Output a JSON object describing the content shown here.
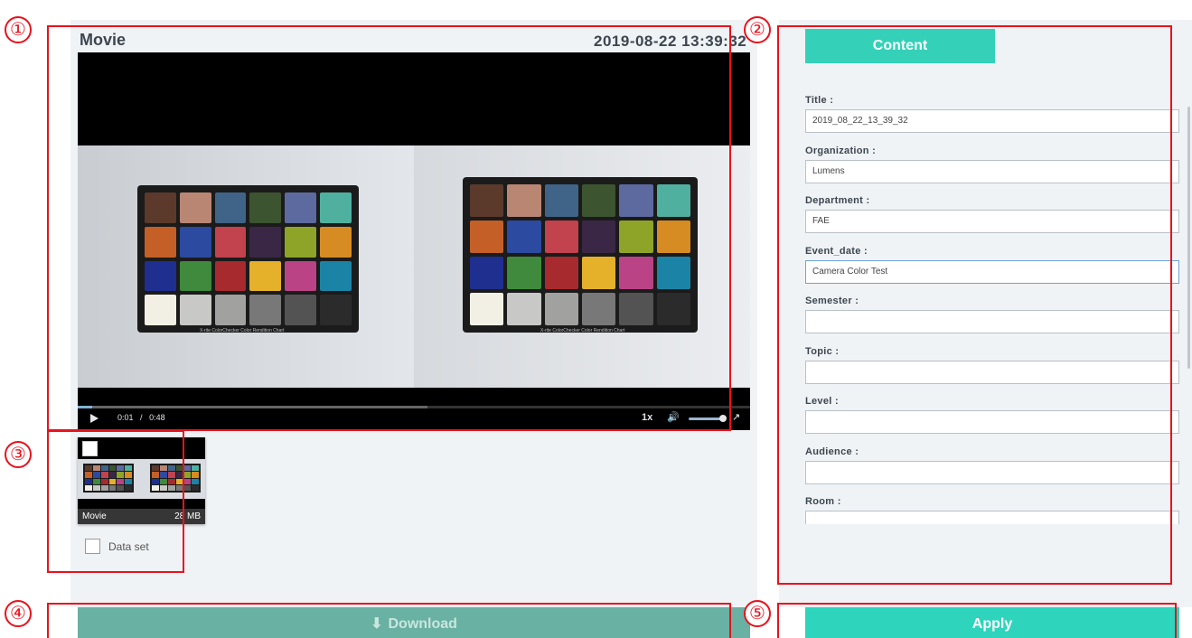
{
  "player": {
    "title": "Movie",
    "timestamp": "2019-08-22  13:39:32",
    "current_time": "0:01",
    "separator": "/",
    "duration": "0:48",
    "speed": "1x",
    "progress_fraction": 0.021,
    "buffered_fraction": 0.52,
    "volume_fraction": 1.0,
    "chart_caption": "X-rite ColorChecker  Color Rendition Chart",
    "icons": {
      "play": "play-icon",
      "volume": "volume-icon",
      "fullscreen": "fullscreen-icon"
    },
    "swatch_colors": [
      "#5b3a2c",
      "#b98673",
      "#3f6488",
      "#3c5530",
      "#5d6aa0",
      "#4fb0a0",
      "#c45f27",
      "#2b4aa0",
      "#c2424d",
      "#3a2746",
      "#8ea429",
      "#d68c23",
      "#1f2f8f",
      "#3f8a3c",
      "#a72b2e",
      "#e5b02a",
      "#b94384",
      "#1b84a6",
      "#f2f0e4",
      "#c8c8c6",
      "#a1a1a0",
      "#787878",
      "#535353",
      "#2b2b2b"
    ]
  },
  "thumbnail": {
    "name": "Movie",
    "size": "28 MB",
    "checkbox_checked": false
  },
  "dataset": {
    "label": "Data set",
    "checked": false
  },
  "content": {
    "tab_label": "Content",
    "fields": [
      {
        "label": "Title :",
        "value": "2019_08_22_13_39_32"
      },
      {
        "label": "Organization :",
        "value": "Lumens"
      },
      {
        "label": "Department :",
        "value": "FAE"
      },
      {
        "label": "Event_date :",
        "value": "Camera Color Test"
      },
      {
        "label": "Semester :",
        "value": ""
      },
      {
        "label": "Topic :",
        "value": ""
      },
      {
        "label": "Level :",
        "value": ""
      },
      {
        "label": "Audience :",
        "value": ""
      },
      {
        "label": "Room :",
        "value": ""
      }
    ]
  },
  "buttons": {
    "download": "Download",
    "apply": "Apply"
  },
  "annotations": [
    "①",
    "②",
    "③",
    "④",
    "⑤"
  ],
  "colors": {
    "accent": "#2fd4bd",
    "download_bg": "#68b1a3",
    "highlight": "#e8121d",
    "panel_bg": "#f0f3f6"
  }
}
